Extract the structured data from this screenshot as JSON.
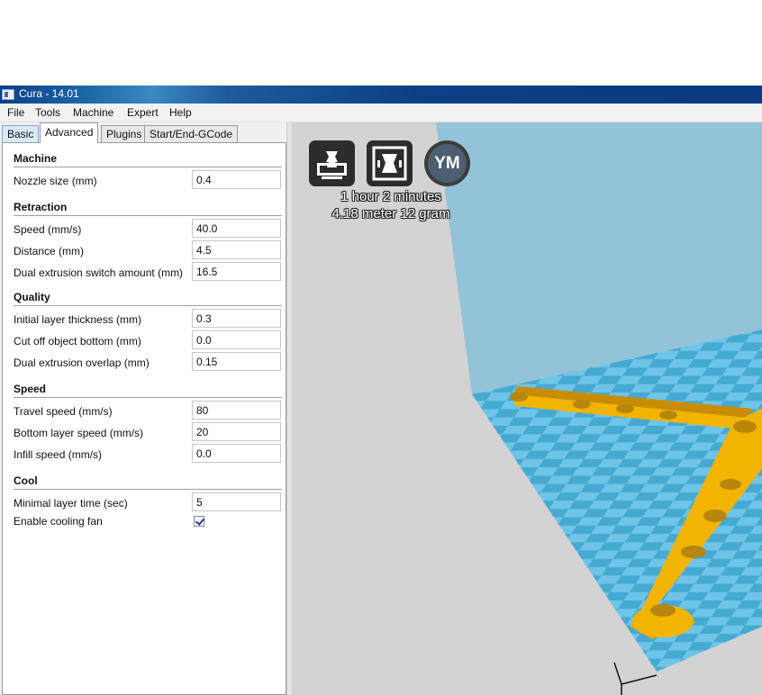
{
  "window": {
    "title": "Cura - 14.01"
  },
  "menu": [
    "File",
    "Tools",
    "Machine",
    "Expert",
    "Help"
  ],
  "tabs": [
    "Basic",
    "Advanced",
    "Plugins",
    "Start/End-GCode"
  ],
  "sections": {
    "machine": {
      "title": "Machine",
      "fields": [
        {
          "label": "Nozzle size (mm)",
          "value": "0.4"
        }
      ]
    },
    "retraction": {
      "title": "Retraction",
      "fields": [
        {
          "label": "Speed (mm/s)",
          "value": "40.0"
        },
        {
          "label": "Distance (mm)",
          "value": "4.5"
        },
        {
          "label": "Dual extrusion switch amount (mm)",
          "value": "16.5"
        }
      ]
    },
    "quality": {
      "title": "Quality",
      "fields": [
        {
          "label": "Initial layer thickness (mm)",
          "value": "0.3"
        },
        {
          "label": "Cut off object bottom (mm)",
          "value": "0.0"
        },
        {
          "label": "Dual extrusion overlap (mm)",
          "value": "0.15"
        }
      ]
    },
    "speed": {
      "title": "Speed",
      "fields": [
        {
          "label": "Travel speed (mm/s)",
          "value": "80"
        },
        {
          "label": "Bottom layer speed (mm/s)",
          "value": "20"
        },
        {
          "label": "Infill speed (mm/s)",
          "value": "0.0"
        }
      ]
    },
    "cool": {
      "title": "Cool",
      "fields": [
        {
          "label": "Minimal layer time (sec)",
          "value": "5"
        }
      ],
      "checkbox": {
        "label": "Enable cooling fan",
        "checked": true
      }
    }
  },
  "viewport": {
    "toolbar": {
      "load_icon": "load-model-icon",
      "view_mode_icon": "view-mode-icon",
      "ym_label": "YM"
    },
    "print_time": "1 hour 2 minutes",
    "print_material": "4.18 meter 12 gram",
    "colors": {
      "background": "#d3d3d3",
      "back_wall": "#93c3d8",
      "plate_light": "#6ec5e8",
      "plate_dark": "#46a9d1",
      "model": "#f2b400"
    }
  }
}
